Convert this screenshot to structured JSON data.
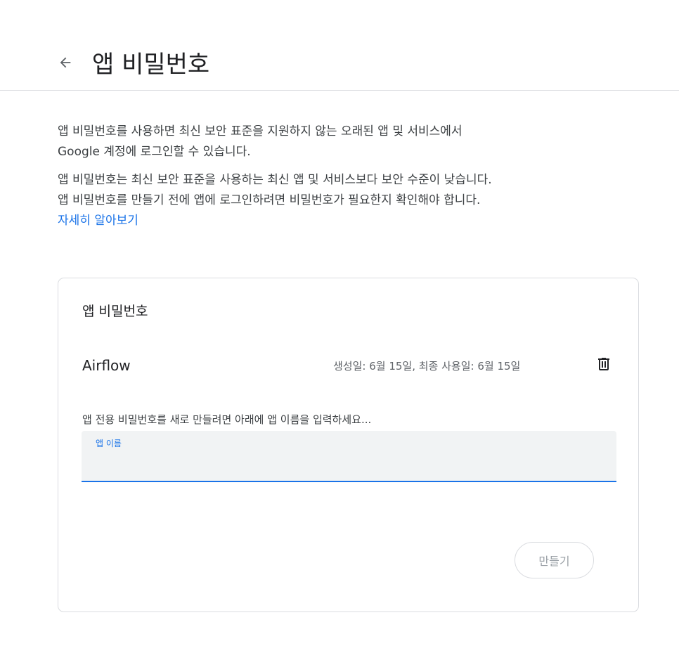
{
  "header": {
    "title": "앱 비밀번호",
    "back_icon": "arrow-back-icon"
  },
  "intro": {
    "paragraph1_line1": "앱 비밀번호를 사용하면 최신 보안 표준을 지원하지 않는 오래된 앱 및 서비스에서",
    "paragraph1_line2": "Google 계정에 로그인할 수 있습니다.",
    "paragraph2_line1": "앱 비밀번호는 최신 보안 표준을 사용하는 최신 앱 및 서비스보다 보안 수준이 낮습니다.",
    "paragraph2_line2": "앱 비밀번호를 만들기 전에 앱에 로그인하려면 비밀번호가 필요한지 확인해야 합니다.",
    "learn_more": "자세히 알아보기"
  },
  "card": {
    "title": "앱 비밀번호",
    "passwords": [
      {
        "name": "Airflow",
        "dates": "생성일: 6월 15일, 최종 사용일: 6월 15일",
        "delete_icon": "trash-icon"
      }
    ],
    "helper_text": "앱 전용 비밀번호를 새로 만들려면 아래에 앱 이름을 입력하세요...",
    "input": {
      "label": "앱 이름",
      "value": ""
    },
    "create_label": "만들기"
  },
  "colors": {
    "accent": "#1a73e8",
    "border": "#dadce0",
    "field_bg": "#f1f3f4",
    "disabled_text": "#9aa0a6"
  }
}
